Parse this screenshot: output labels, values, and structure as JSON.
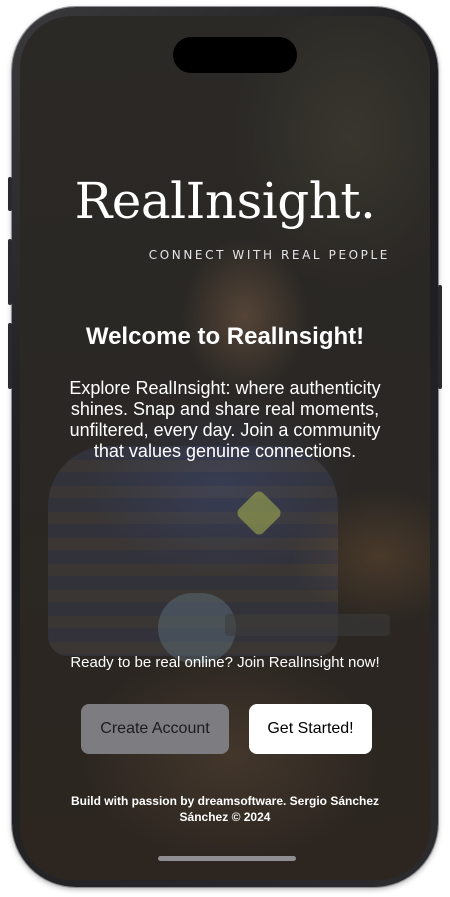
{
  "app": {
    "logo": "RealInsight.",
    "tagline": "CONNECT WITH REAL PEOPLE"
  },
  "welcome": {
    "title": "Welcome to RealInsight!",
    "description": "Explore RealInsight: where authenticity shines. Snap and share real moments, unfiltered, every day. Join a community that values genuine connections."
  },
  "cta": {
    "text": "Ready to be real online? Join RealInsight now!",
    "create_account_label": "Create Account",
    "get_started_label": "Get Started!"
  },
  "footer": {
    "text": "Build with passion by dreamsoftware. Sergio Sánchez Sánchez © 2024"
  },
  "colors": {
    "secondary_button": "#7d7c80",
    "primary_button": "#ffffff",
    "text": "#ffffff"
  }
}
